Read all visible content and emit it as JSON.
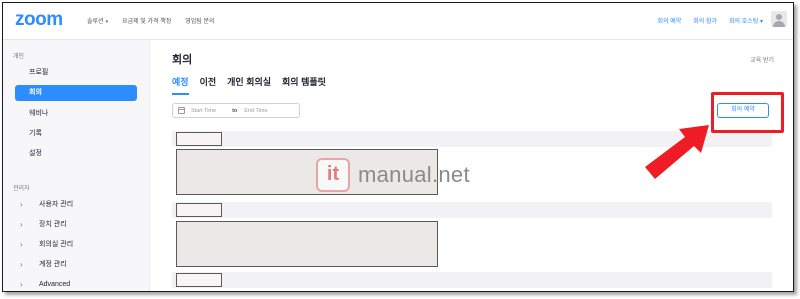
{
  "app": {
    "logo": "zoom"
  },
  "topnav": {
    "left": [
      {
        "label": "솔루션",
        "caret": "▾"
      },
      {
        "label": "요금제 및 가격 책정",
        "caret": ""
      },
      {
        "label": "영업팀 문의",
        "caret": ""
      }
    ],
    "right": {
      "schedule": "회의 예약",
      "join": "회의 참가",
      "host": "회의 호스팅",
      "host_caret": "▾"
    },
    "avatar_icon": "user-avatar-icon"
  },
  "sidebar": {
    "personal_heading": "개인",
    "personal_items": [
      {
        "label": "프로필"
      },
      {
        "label": "회의"
      },
      {
        "label": "웨비나"
      },
      {
        "label": "기록"
      },
      {
        "label": "설정"
      }
    ],
    "admin_heading": "관리자",
    "admin_items": [
      {
        "label": "사용자 관리"
      },
      {
        "label": "장치 관리"
      },
      {
        "label": "회의실 관리"
      },
      {
        "label": "계정 관리"
      },
      {
        "label": "Advanced"
      }
    ]
  },
  "main": {
    "title": "회의",
    "training_link": "교육 받기",
    "tabs": [
      {
        "label": "예정"
      },
      {
        "label": "이전"
      },
      {
        "label": "개인 회의실"
      },
      {
        "label": "회의 템플릿"
      }
    ],
    "date_range": {
      "start": "Start Time",
      "to": "to",
      "end": "End Time"
    },
    "schedule_button": "회의 예약"
  },
  "watermark": {
    "badge": "it",
    "text": "manual.net"
  },
  "colors": {
    "brand": "#2d8cff",
    "highlight": "#ee1c24",
    "sidebar_bg": "#f7f7f9"
  }
}
